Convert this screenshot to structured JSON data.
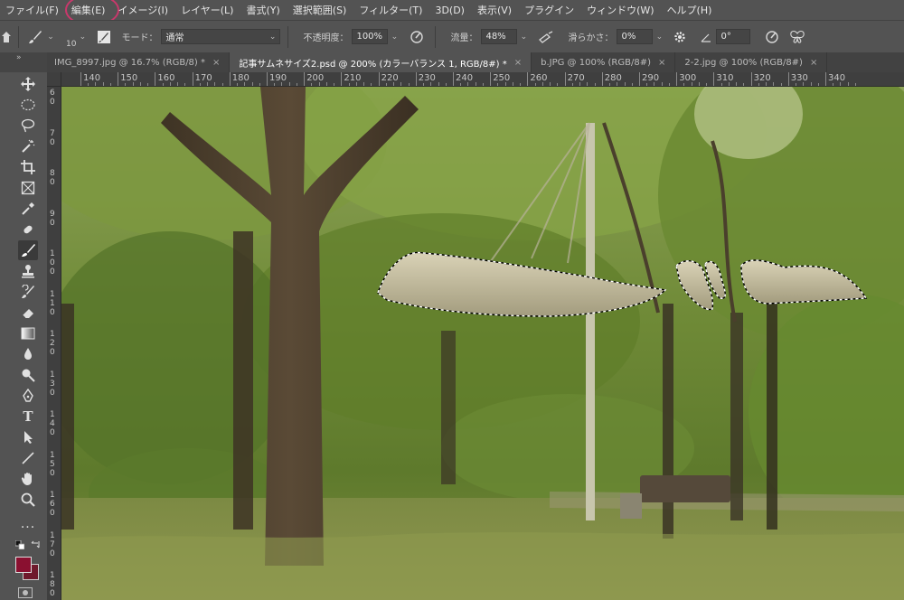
{
  "menu": {
    "items": [
      "ファイル(F)",
      "編集(E)",
      "イメージ(I)",
      "レイヤー(L)",
      "書式(Y)",
      "選択範囲(S)",
      "フィルター(T)",
      "3D(D)",
      "表示(V)",
      "プラグイン",
      "ウィンドウ(W)",
      "ヘルプ(H)"
    ]
  },
  "options": {
    "brush_size": "10",
    "mode_label": "モード：",
    "mode_value": "通常",
    "opacity_label": "不透明度：",
    "opacity_value": "100%",
    "flow_label": "流量：",
    "flow_value": "48%",
    "smoothing_label": "滑らかさ：",
    "smoothing_value": "0%",
    "angle_value": "0°"
  },
  "tabs": [
    {
      "label": "IMG_8997.jpg @ 16.7% (RGB/8) *",
      "active": false
    },
    {
      "label": "記事サムネサイズ2.psd @ 200% (カラーバランス 1, RGB/8#) *",
      "active": true
    },
    {
      "label": "b.JPG @ 100% (RGB/8#)",
      "active": false
    },
    {
      "label": "2-2.jpg @ 100% (RGB/8#)",
      "active": false
    }
  ],
  "ruler": {
    "h_labels": [
      "140",
      "150",
      "160",
      "170",
      "180",
      "190",
      "200",
      "210",
      "220",
      "230",
      "240",
      "250",
      "260",
      "270",
      "280",
      "290",
      "300",
      "310",
      "320",
      "330",
      "340"
    ],
    "v_labels": [
      "60",
      "70",
      "80",
      "90",
      "100",
      "110",
      "120",
      "130",
      "140",
      "150",
      "160",
      "170",
      "180"
    ]
  },
  "colors": {
    "foreground": "#8a1030",
    "background": "#6f1a2c",
    "menu_highlight": "#c8386b"
  },
  "icons": {
    "toolbar": [
      "move-icon",
      "marquee-icon",
      "lasso-icon",
      "magic-wand-icon",
      "crop-icon",
      "frame-icon",
      "eyedropper-icon",
      "healing-brush-icon",
      "brush-icon",
      "clone-stamp-icon",
      "history-brush-icon",
      "eraser-icon",
      "gradient-icon",
      "blur-icon",
      "dodge-icon",
      "pen-icon",
      "type-icon",
      "path-select-icon",
      "line-icon",
      "hand-icon",
      "zoom-icon",
      "more-tools-icon"
    ]
  }
}
